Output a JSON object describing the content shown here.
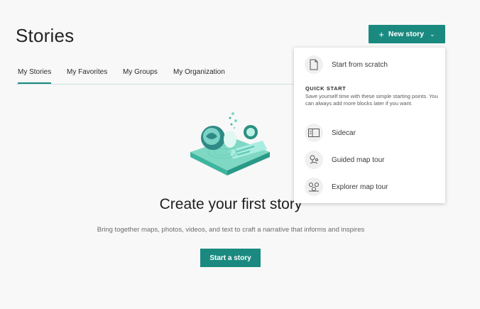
{
  "header": {
    "title": "Stories",
    "new_story_label": "New story"
  },
  "tabs": [
    {
      "label": "My Stories",
      "active": true
    },
    {
      "label": "My Favorites",
      "active": false
    },
    {
      "label": "My Groups",
      "active": false
    },
    {
      "label": "My Organization",
      "active": false
    }
  ],
  "empty_state": {
    "title": "Create your first story",
    "subtitle": "Bring together maps, photos, videos, and text to craft a narrative that informs and inspires",
    "button_label": "Start a story"
  },
  "dropdown": {
    "scratch_label": "Start from scratch",
    "quick_start_heading": "QUICK START",
    "quick_start_description": "Save yourself time with these simple starting points. You can always add more blocks later if you want.",
    "items": [
      {
        "label": "Sidecar",
        "icon": "sidecar-icon"
      },
      {
        "label": "Guided map tour",
        "icon": "guided-map-tour-icon"
      },
      {
        "label": "Explorer map tour",
        "icon": "explorer-map-tour-icon"
      }
    ]
  },
  "colors": {
    "accent": "#1a8a80",
    "background": "#f8f8f8"
  }
}
